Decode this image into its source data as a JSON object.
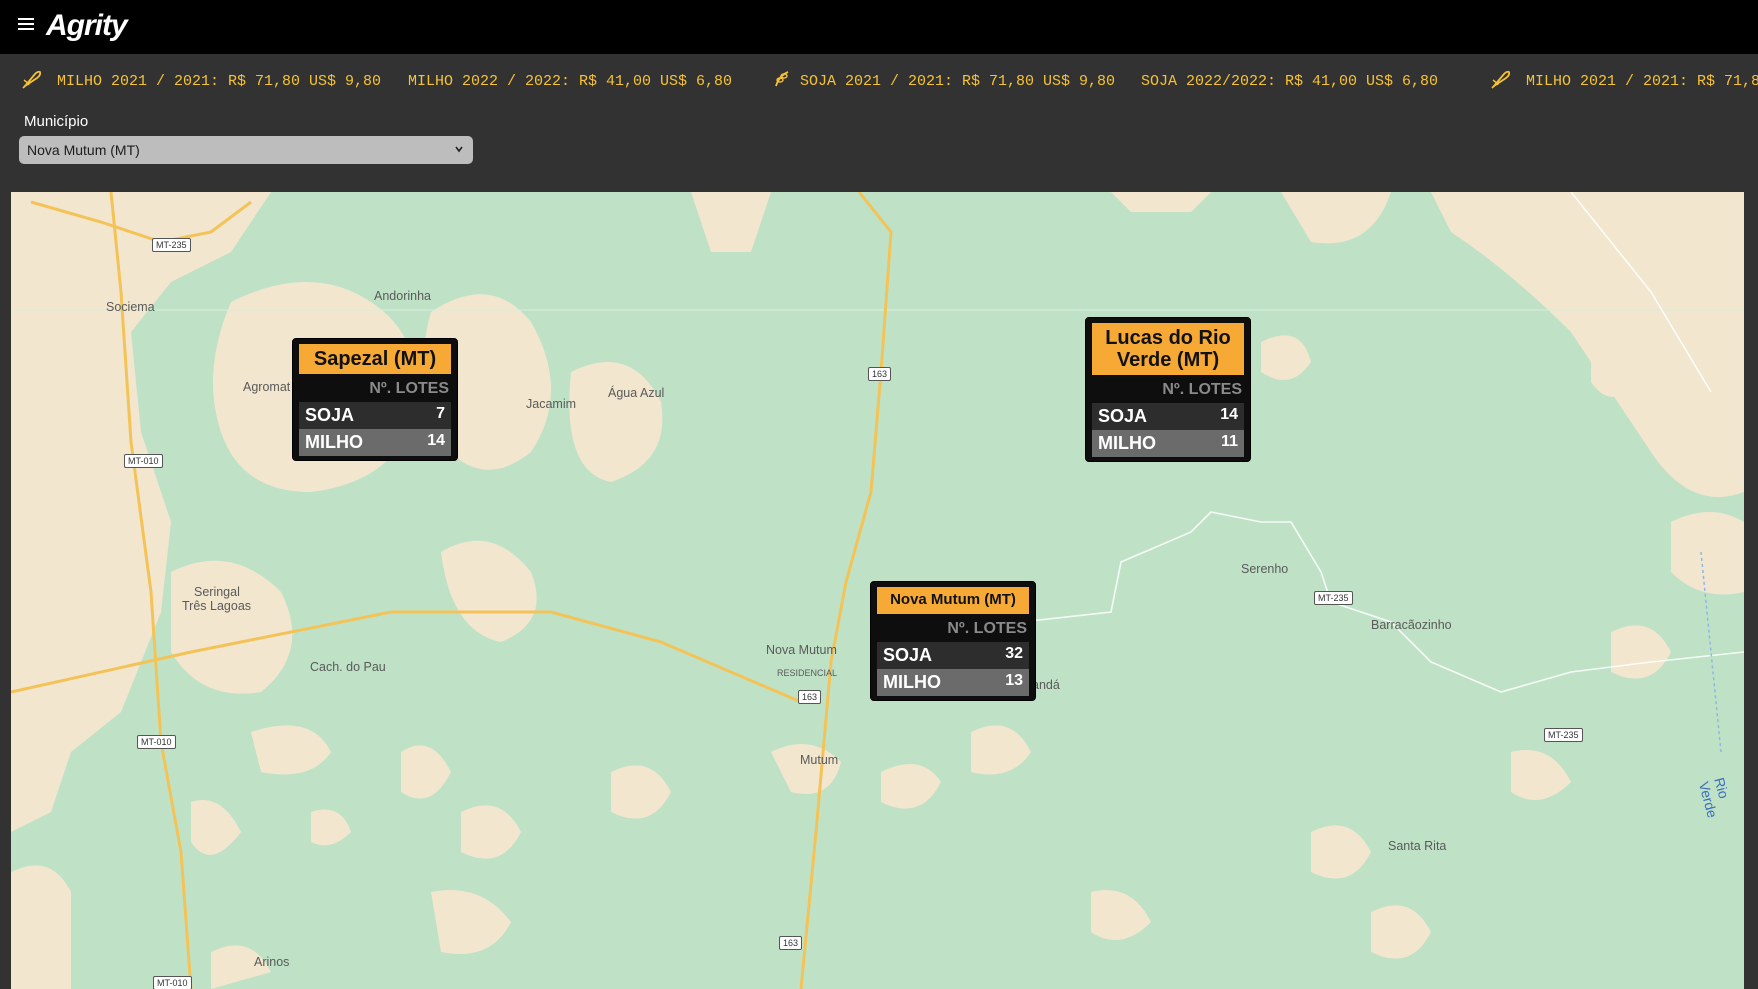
{
  "header": {
    "brand": "Agrity"
  },
  "ticker": [
    {
      "text": "MILHO 2021 / 2021: R$ 71,80 US$ 9,80",
      "icon": "corn-icon"
    },
    {
      "text": "MILHO 2022 / 2022: R$ 41,00 US$ 6,80",
      "icon": ""
    },
    {
      "text": "SOJA 2021 / 2021: R$ 71,80 US$ 9,80",
      "icon": "soy-icon"
    },
    {
      "text": "SOJA 2022/2022: R$ 41,00 US$ 6,80",
      "icon": ""
    },
    {
      "text": "MILHO 2021 / 2021: R$ 71,8",
      "icon": "corn-icon"
    }
  ],
  "filter": {
    "label": "Município",
    "value": "Nova Mutum (MT)"
  },
  "map": {
    "places": [
      "Andorinha",
      "Sociema",
      "Agromat",
      "Jacamim",
      "Água Azul",
      "Seringal Três Lagoas",
      "Cach. do Pau",
      "Nova Mutum",
      "RESIDENCIAL",
      "Mutum",
      "andá",
      "Serenho",
      "Barracãozinho",
      "Santa Rita",
      "Arinos"
    ],
    "seringal_line1": "Seringal",
    "seringal_line2": "Três Lagoas",
    "roads": [
      "MT-235",
      "MT-010",
      "MT-010",
      "163",
      "163",
      "163",
      "MT-235",
      "MT-235",
      "MT-010"
    ],
    "river": "Rio Verde",
    "colors": {
      "land": "#bfe2c7",
      "urban": "#f2e6cf",
      "highway": "#f4c357",
      "card_title": "#f6a934"
    }
  },
  "cards": [
    {
      "title": "Sapezal (MT)",
      "header": "Nº. LOTES",
      "soja_label": "SOJA",
      "soja": "7",
      "milho_label": "MILHO",
      "milho": "14"
    },
    {
      "title": "Lucas do Rio Verde (MT)",
      "header": "Nº. LOTES",
      "soja_label": "SOJA",
      "soja": "14",
      "milho_label": "MILHO",
      "milho": "11"
    },
    {
      "title": "Nova Mutum (MT)",
      "header": "Nº. LOTES",
      "soja_label": "SOJA",
      "soja": "32",
      "milho_label": "MILHO",
      "milho": "13"
    }
  ]
}
